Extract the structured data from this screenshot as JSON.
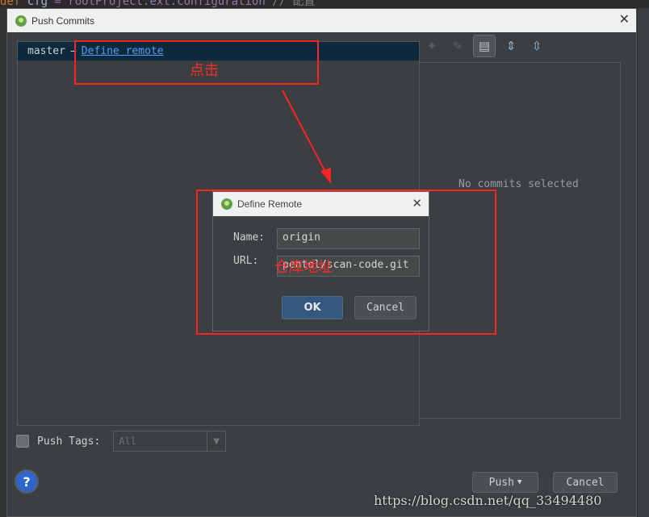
{
  "background_code": {
    "kw": "def",
    "id": "cfg",
    "rest": " = rootProject.ext.configuration",
    "comment": " // 配置"
  },
  "window": {
    "title": "Push Commits"
  },
  "repo": {
    "branch": "master",
    "arrow": "→",
    "define_remote_link": "Define remote"
  },
  "commits": {
    "empty_text": "No commits selected"
  },
  "push_tags": {
    "label": "Push Tags:",
    "select_value": "All",
    "checked": false
  },
  "buttons": {
    "help": "?",
    "push": "Push",
    "cancel": "Cancel"
  },
  "define_remote": {
    "title": "Define Remote",
    "name_label": "Name:",
    "name_value": "origin",
    "url_label": "URL:",
    "url_value": "pentol/scan-code.git",
    "ok": "OK",
    "cancel": "Cancel"
  },
  "annotations": {
    "click_note": "点击",
    "url_note": "仓库地址",
    "color": "#ff2222"
  },
  "watermark": "https://blog.csdn.net/qq_33494480",
  "colors": {
    "link": "#589df6",
    "selected_row": "#0d293e",
    "ok_button": "#365880"
  }
}
